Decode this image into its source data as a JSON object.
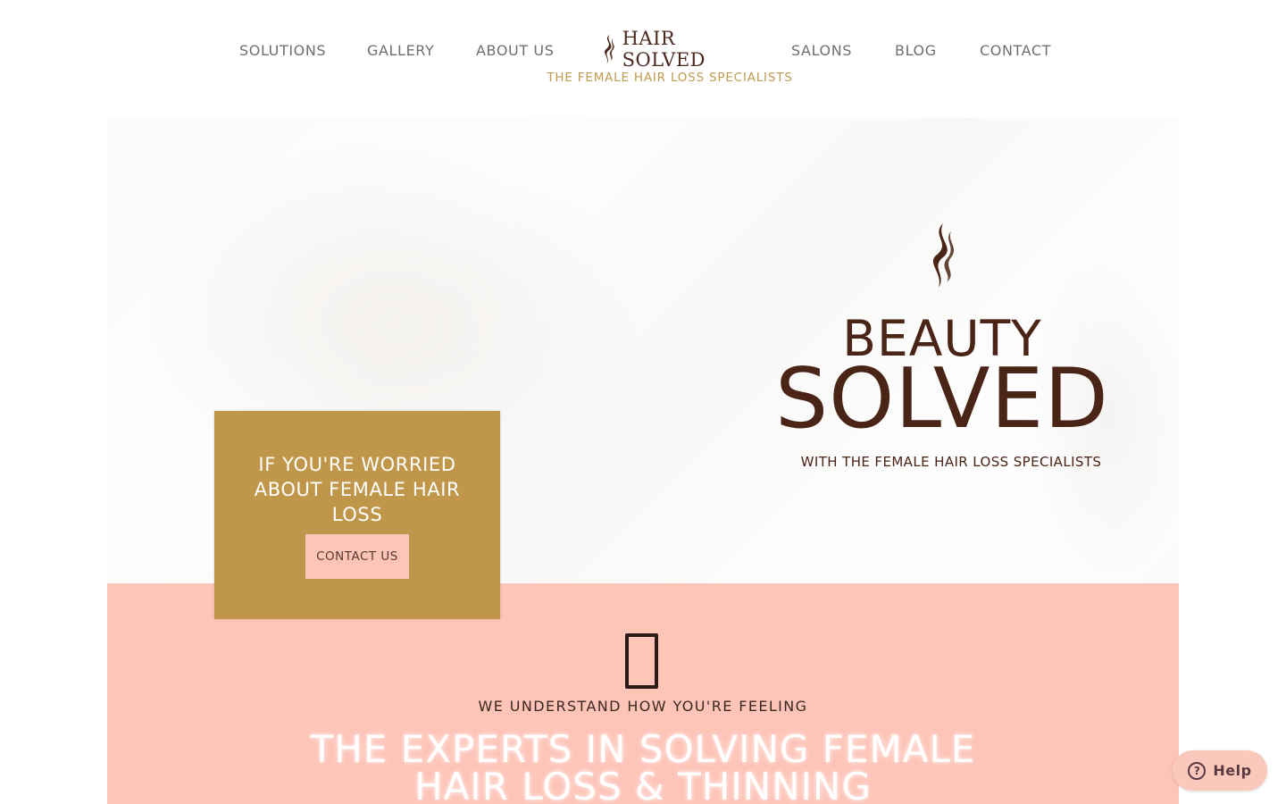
{
  "nav": {
    "items_left": [
      {
        "label": "SOLUTIONS"
      },
      {
        "label": "GALLERY"
      },
      {
        "label": "ABOUT US"
      }
    ],
    "items_right": [
      {
        "label": "SALONS"
      },
      {
        "label": "BLOG"
      },
      {
        "label": "CONTACT"
      }
    ],
    "logo_text": "HAIR SOLVED",
    "tagline": "THE FEMALE HAIR LOSS SPECIALISTS"
  },
  "hero": {
    "heading_line1": "BEAUTY",
    "heading_line2": "SOLVED",
    "subheading": "WITH THE FEMALE HAIR LOSS SPECIALISTS",
    "icon": "flame-logo-icon"
  },
  "card": {
    "text": "IF YOU'RE WORRIED ABOUT FEMALE HAIR LOSS",
    "button_label": "CONTACT US"
  },
  "section": {
    "icon": "missing-glyph-box-icon",
    "kicker": "WE UNDERSTAND HOW YOU'RE FEELING",
    "heading": "THE EXPERTS IN SOLVING FEMALE HAIR LOSS & THINNING"
  },
  "help": {
    "label": "Help",
    "icon": "question-circle-icon"
  },
  "colors": {
    "gold": "#c0974a",
    "brown": "#4a2416",
    "pink": "#fec4b8",
    "nav_text": "#6f6f6f",
    "tagline": "#c09b4f"
  }
}
